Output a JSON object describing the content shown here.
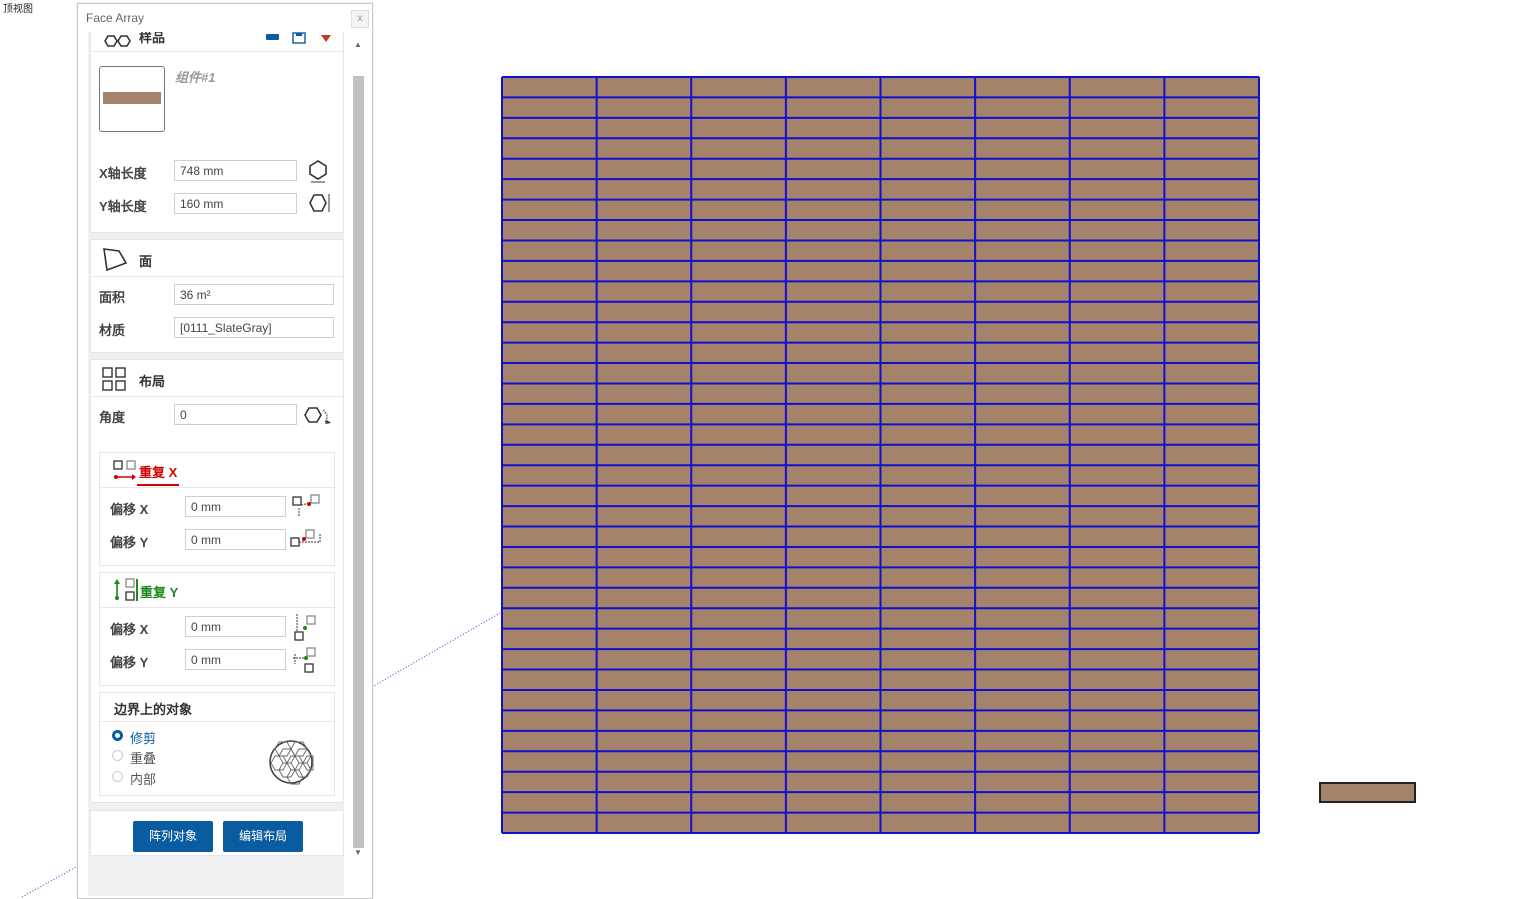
{
  "viewport": {
    "view_label": "顶视图"
  },
  "panel": {
    "title": "Face Array",
    "close_label": "x",
    "component": {
      "header_label": "样品",
      "name": "组件#1",
      "x_length_label": "X轴长度",
      "x_length_value": "748 mm",
      "y_length_label": "Y轴长度",
      "y_length_value": "160 mm",
      "swatch_color": "#a5836a"
    },
    "face": {
      "header_label": "面",
      "area_label": "面积",
      "area_value": "36 m²",
      "material_label": "材质",
      "material_value": "[0111_SlateGray]"
    },
    "layout": {
      "header_label": "布局",
      "angle_label": "角度",
      "angle_value": "0",
      "repeat_x": {
        "title": "重复 X",
        "color": "#d40000",
        "offset_x_label": "偏移 X",
        "offset_x_value": "0 mm",
        "offset_y_label": "偏移 Y",
        "offset_y_value": "0 mm"
      },
      "repeat_y": {
        "title": "重复 Y",
        "color": "#1a8a1a",
        "offset_x_label": "偏移 X",
        "offset_x_value": "0 mm",
        "offset_y_label": "偏移 Y",
        "offset_y_value": "0 mm"
      },
      "boundary": {
        "title": "边界上的对象",
        "options": [
          "修剪",
          "重叠",
          "内部"
        ],
        "selected": "修剪"
      }
    },
    "buttons": {
      "array_label": "阵列对象",
      "edit_label": "编辑布局"
    }
  },
  "tile_grid": {
    "columns": 8,
    "rows": 37,
    "tile_color": "#a5836a",
    "line_color": "#1010d0"
  },
  "accent_color": "#0a5ca0"
}
